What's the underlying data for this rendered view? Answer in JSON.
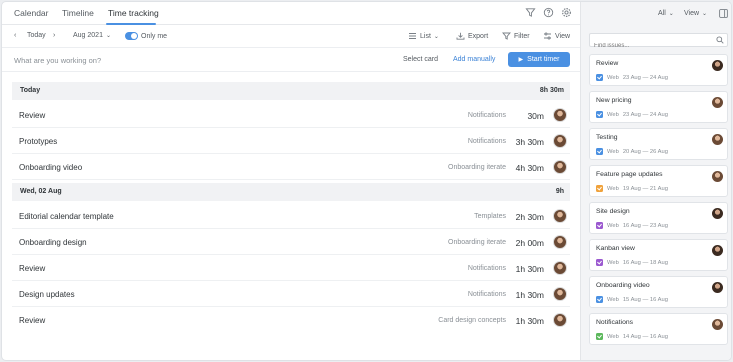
{
  "tabs": [
    "Calendar",
    "Timeline",
    "Time tracking"
  ],
  "toolbar": {
    "today": "Today",
    "month": "Aug 2021",
    "only_me": "Only me",
    "list": "List",
    "export": "Export",
    "filter": "Filter",
    "view": "View"
  },
  "entry": {
    "placeholder": "What are you working on?",
    "select_card": "Select card",
    "add_manually": "Add manually",
    "start_timer": "Start timer"
  },
  "groups": [
    {
      "title": "Today",
      "total": "8h 30m",
      "rows": [
        {
          "title": "Review",
          "project": "Notifications",
          "time": "30m"
        },
        {
          "title": "Prototypes",
          "project": "Notifications",
          "time": "3h 30m"
        },
        {
          "title": "Onboarding video",
          "project": "Onboarding iterate",
          "time": "4h 30m"
        }
      ]
    },
    {
      "title": "Wed, 02 Aug",
      "total": "9h",
      "rows": [
        {
          "title": "Editorial calendar template",
          "project": "Templates",
          "time": "2h 30m"
        },
        {
          "title": "Onboarding design",
          "project": "Onboarding iterate",
          "time": "2h 00m"
        },
        {
          "title": "Review",
          "project": "Notifications",
          "time": "1h 30m"
        },
        {
          "title": "Design updates",
          "project": "Notifications",
          "time": "1h 30m"
        },
        {
          "title": "Review",
          "project": "Card design concepts",
          "time": "1h 30m"
        }
      ]
    }
  ],
  "side": {
    "all": "All",
    "view": "View",
    "search_placeholder": "Find issues...",
    "cards": [
      {
        "title": "Review",
        "tag": "Web",
        "dates": "23 Aug — 24 Aug",
        "badge_color": "#4a90e2",
        "badge_icon": "check-badge-icon"
      },
      {
        "title": "New pricing",
        "tag": "Web",
        "dates": "23 Aug — 24 Aug",
        "badge_color": "#4a90e2",
        "badge_icon": "check-badge-icon"
      },
      {
        "title": "Testing",
        "tag": "Web",
        "dates": "20 Aug — 26 Aug",
        "badge_color": "#4a90e2",
        "badge_icon": "check-badge-icon"
      },
      {
        "title": "Feature page updates",
        "tag": "Web",
        "dates": "19 Aug — 21 Aug",
        "badge_color": "#f0a23b",
        "badge_icon": "exclamation-badge-icon"
      },
      {
        "title": "Site design",
        "tag": "Web",
        "dates": "16 Aug — 23 Aug",
        "badge_color": "#9b59d0",
        "badge_icon": "story-badge-icon"
      },
      {
        "title": "Kanban view",
        "tag": "Web",
        "dates": "16 Aug — 18 Aug",
        "badge_color": "#9b59d0",
        "badge_icon": "story-badge-icon"
      },
      {
        "title": "Onboarding video",
        "tag": "Web",
        "dates": "15 Aug — 16 Aug",
        "badge_color": "#4a90e2",
        "badge_icon": "check-badge-icon"
      },
      {
        "title": "Notifications",
        "tag": "Web",
        "dates": "14 Aug — 16 Aug",
        "badge_color": "#5cb85c",
        "badge_icon": "bookmark-badge-icon"
      }
    ]
  },
  "colors": {
    "accent": "#4a90e2",
    "link": "#3b82d6"
  }
}
